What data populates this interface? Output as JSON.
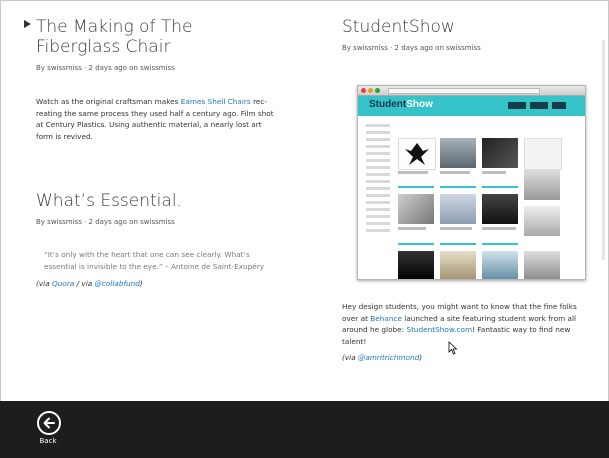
{
  "articles": [
    {
      "title": "The Making of The Fiberglass Chair",
      "meta": "By swissmiss · 2 days ago on swissmiss",
      "body_pre": "Watch as the original craftsman makes ",
      "body_link": "Eames Shell Chairs",
      "body_post": " rec-reating the same process they used half a century ago. Film shot at Century Plastics. Using authentic material, a nearly lost art form is revived."
    },
    {
      "title": "What’s Essential.",
      "meta": "By swissmiss · 2 days ago on swissmiss",
      "quote": "“It’s only with the heart that one can see clearly. What’s essential is invisible to the eye.” – Antoine de Saint-Exupéry",
      "via_open": "(via ",
      "via_link1": "Quora",
      "via_mid": " / via ",
      "via_link2": "@collabfund",
      "via_close": ")"
    },
    {
      "title": "StudentShow",
      "meta": "By swissmiss · 2 days ago on swissmiss",
      "body_a": "Hey design students, you might want to know that the fine folks over at ",
      "body_link1": "Behance",
      "body_b": " launched a site featuring student work from all around he globe: ",
      "body_link2": "StudentShow.com",
      "body_c": "! Fantastic way to find new talent!",
      "via_open": "(via ",
      "via_link": "@amritrichmond",
      "via_close": ")"
    }
  ],
  "screenshot": {
    "brand_left": "Student",
    "brand_right": "Show",
    "accent": "#36c2c9"
  },
  "appbar": {
    "back_label": "Back",
    "icon": "back-arrow-icon"
  },
  "colors": {
    "link": "#1b78c2",
    "appbar": "#1d1d1d"
  }
}
